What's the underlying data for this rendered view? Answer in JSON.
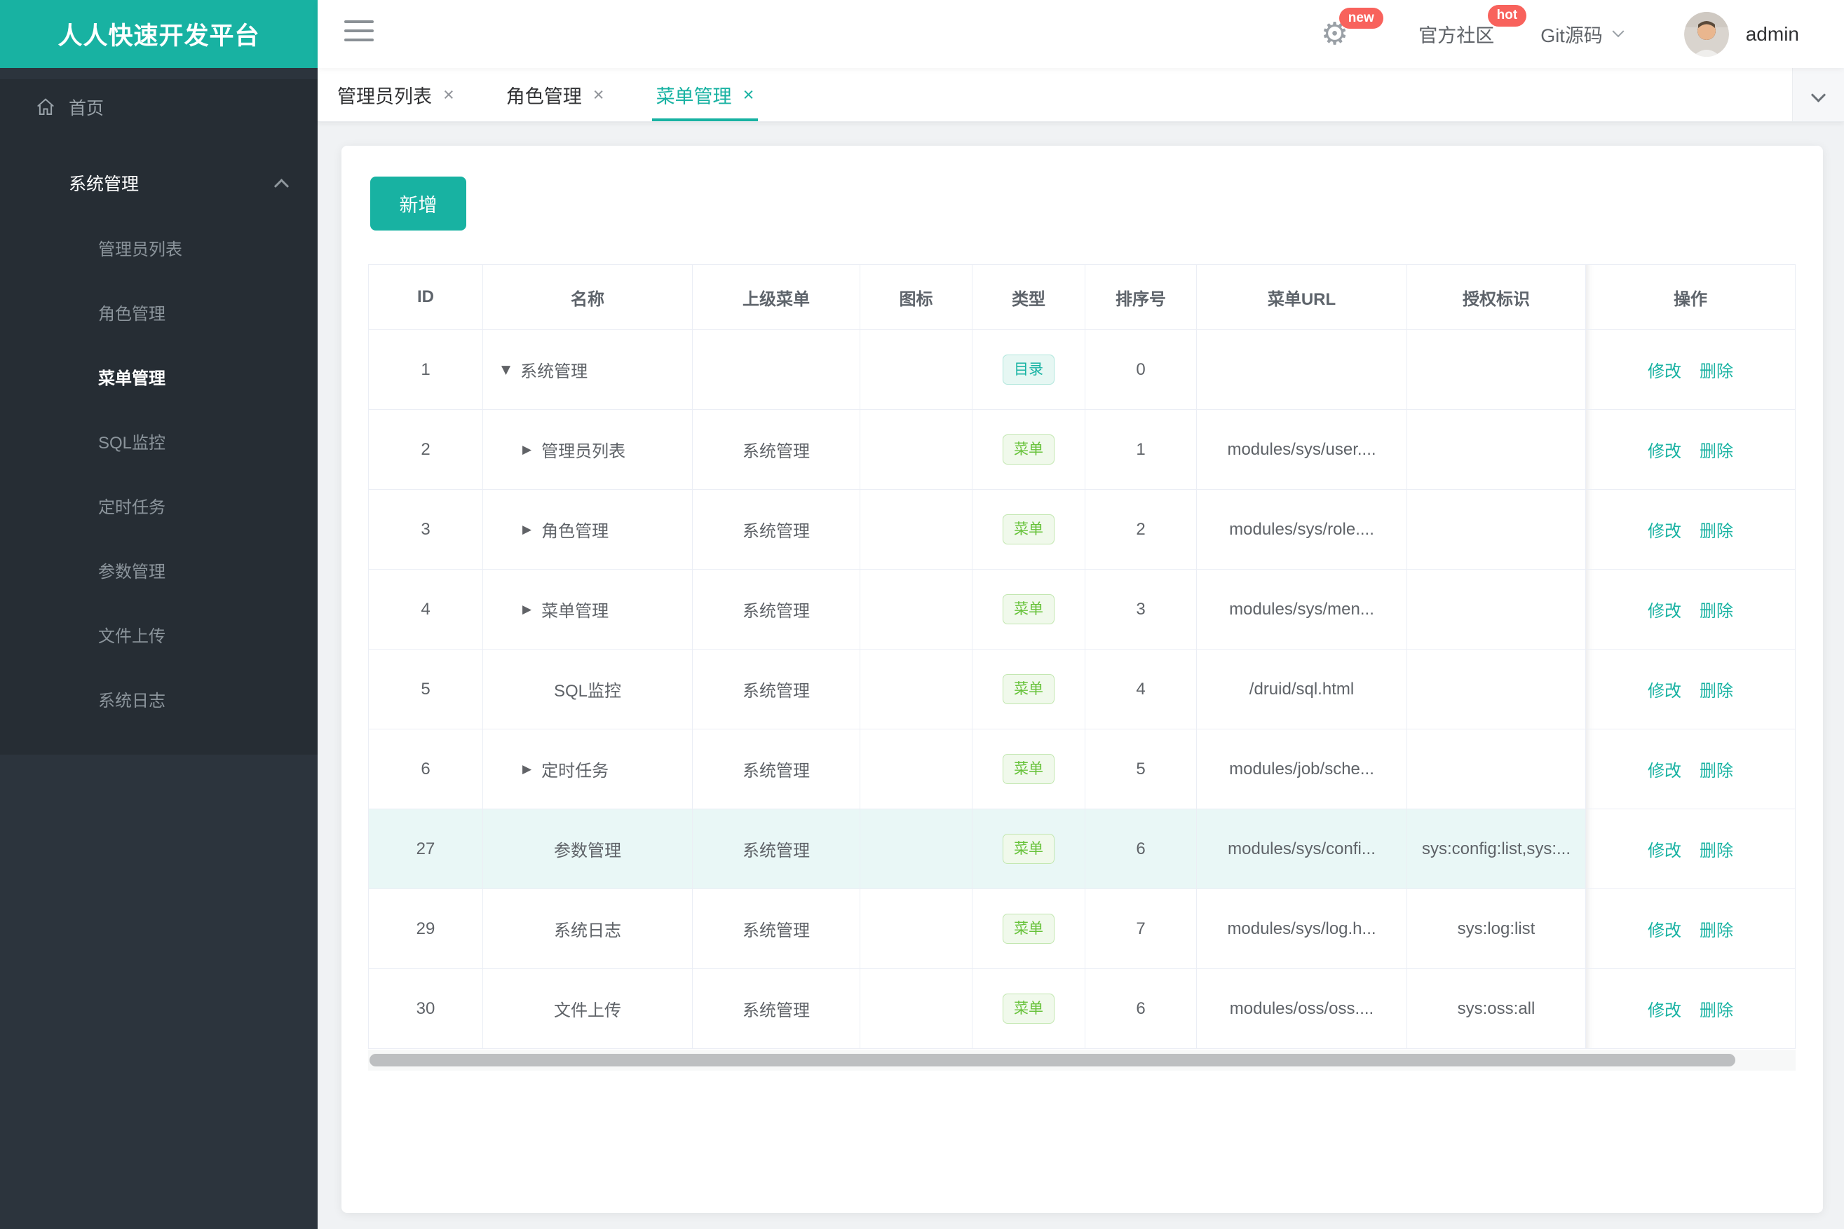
{
  "app": {
    "title": "人人快速开发平台",
    "user": "admin"
  },
  "topbar": {
    "gear_badge": "new",
    "community_label": "官方社区",
    "community_badge": "hot",
    "git_label": "Git源码"
  },
  "sidebar": {
    "home_label": "首页",
    "group_label": "系统管理",
    "items": [
      {
        "label": "管理员列表",
        "active": false
      },
      {
        "label": "角色管理",
        "active": false
      },
      {
        "label": "菜单管理",
        "active": true
      },
      {
        "label": "SQL监控",
        "active": false
      },
      {
        "label": "定时任务",
        "active": false
      },
      {
        "label": "参数管理",
        "active": false
      },
      {
        "label": "文件上传",
        "active": false
      },
      {
        "label": "系统日志",
        "active": false
      }
    ]
  },
  "tabs": [
    {
      "label": "管理员列表",
      "active": false
    },
    {
      "label": "角色管理",
      "active": false
    },
    {
      "label": "菜单管理",
      "active": true
    }
  ],
  "toolbar": {
    "add_label": "新增"
  },
  "table": {
    "columns": [
      "ID",
      "名称",
      "上级菜单",
      "图标",
      "类型",
      "排序号",
      "菜单URL",
      "授权标识",
      "操作"
    ],
    "edit_label": "修改",
    "delete_label": "删除",
    "rows": [
      {
        "id": "1",
        "arrow": "down",
        "indent": 0,
        "name": "系统管理",
        "parent": "",
        "type": "目录",
        "type_kind": "dir",
        "order": "0",
        "url": "",
        "auth": "",
        "highlight": false
      },
      {
        "id": "2",
        "arrow": "right",
        "indent": 1,
        "name": "管理员列表",
        "parent": "系统管理",
        "type": "菜单",
        "type_kind": "menu",
        "order": "1",
        "url": "modules/sys/user....",
        "auth": "",
        "highlight": false
      },
      {
        "id": "3",
        "arrow": "right",
        "indent": 1,
        "name": "角色管理",
        "parent": "系统管理",
        "type": "菜单",
        "type_kind": "menu",
        "order": "2",
        "url": "modules/sys/role....",
        "auth": "",
        "highlight": false
      },
      {
        "id": "4",
        "arrow": "right",
        "indent": 1,
        "name": "菜单管理",
        "parent": "系统管理",
        "type": "菜单",
        "type_kind": "menu",
        "order": "3",
        "url": "modules/sys/men...",
        "auth": "",
        "highlight": false
      },
      {
        "id": "5",
        "arrow": null,
        "indent": 1,
        "name": "SQL监控",
        "parent": "系统管理",
        "type": "菜单",
        "type_kind": "menu",
        "order": "4",
        "url": "/druid/sql.html",
        "auth": "",
        "highlight": false
      },
      {
        "id": "6",
        "arrow": "right",
        "indent": 1,
        "name": "定时任务",
        "parent": "系统管理",
        "type": "菜单",
        "type_kind": "menu",
        "order": "5",
        "url": "modules/job/sche...",
        "auth": "",
        "highlight": false
      },
      {
        "id": "27",
        "arrow": null,
        "indent": 1,
        "name": "参数管理",
        "parent": "系统管理",
        "type": "菜单",
        "type_kind": "menu",
        "order": "6",
        "url": "modules/sys/confi...",
        "auth": "sys:config:list,sys:...",
        "highlight": true
      },
      {
        "id": "29",
        "arrow": null,
        "indent": 1,
        "name": "系统日志",
        "parent": "系统管理",
        "type": "菜单",
        "type_kind": "menu",
        "order": "7",
        "url": "modules/sys/log.h...",
        "auth": "sys:log:list",
        "highlight": false
      },
      {
        "id": "30",
        "arrow": null,
        "indent": 1,
        "name": "文件上传",
        "parent": "系统管理",
        "type": "菜单",
        "type_kind": "menu",
        "order": "6",
        "url": "modules/oss/oss....",
        "auth": "sys:oss:all",
        "highlight": false
      }
    ]
  },
  "colors": {
    "accent": "#18b2a2",
    "badge_red": "#f8625c",
    "highlight_row": "#e9f7f6",
    "tag_dir": "#17b3a3",
    "tag_menu": "#67c23a"
  }
}
